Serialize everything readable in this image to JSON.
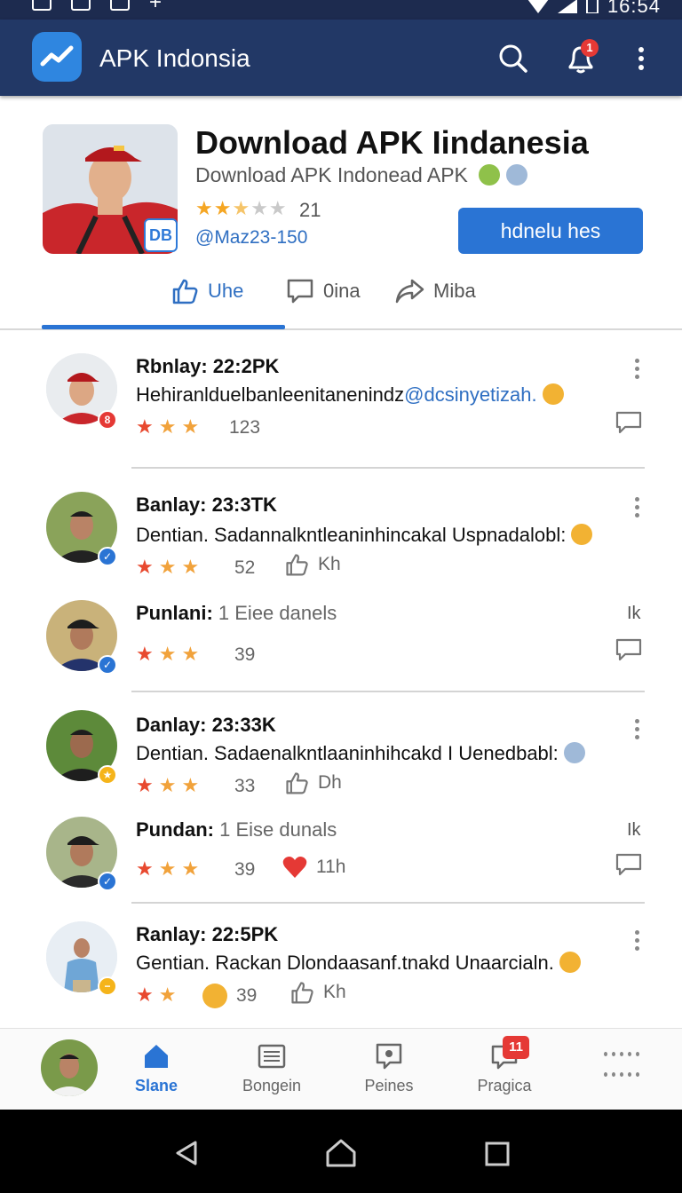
{
  "status_bar": {
    "time": "16:54"
  },
  "app_bar": {
    "title": "APK Indonsia",
    "notification_count": "1",
    "icons": [
      "trending-logo-icon",
      "search-icon",
      "notification-bell-icon",
      "more-vertical-icon"
    ]
  },
  "hero": {
    "title": "Download APK Iindanesia",
    "subtitle": "Download APK Indonead APK",
    "rating": 2.5,
    "rating_count": "21",
    "handle": "@Maz23-150",
    "badge": "DB",
    "button_label": "hdnelu hes",
    "accent_color": "#2a74d4"
  },
  "tabs": [
    {
      "label": "Uhe",
      "icon": "thumbs-up-icon",
      "active": true
    },
    {
      "label": "0ina",
      "icon": "comment-icon",
      "active": false
    },
    {
      "label": "Miba",
      "icon": "share-icon",
      "active": false
    }
  ],
  "feed": [
    {
      "name": "Rbnlay: 22:2PK",
      "text": "Hehiranlduelbanleenitanenindz",
      "mention": "@dcsinyetizah.",
      "rating": 2.5,
      "count": "123",
      "avatar_badge": "8",
      "badge_color": "#e53935",
      "action": "comment"
    },
    {
      "name": "Banlay: 23:3TK",
      "text": "Dentian. Sadannalkntleaninhincakal Uspnadalobl:",
      "rating": 2.5,
      "count": "52",
      "like_label": "Kh",
      "badge_color": "#2a74d4",
      "action": "more"
    },
    {
      "name": "Punlani:",
      "name_light": "1 Eiee danels",
      "right_label": "Ik",
      "rating": 2.5,
      "count": "39",
      "badge_color": "#2a74d4",
      "action": "comment"
    },
    {
      "name": "Danlay: 23:33K",
      "text": "Dentian. Sadaenalkntlaaninhihcakd I Uenedbabl:",
      "rating": 2.5,
      "count": "33",
      "like_label": "Dh",
      "badge_color": "#f5b41a",
      "action": "more"
    },
    {
      "name": "Pundan:",
      "name_light": "1 Eise dunals",
      "right_label": "Ik",
      "rating": 2.5,
      "count": "39",
      "heart_label": "11h",
      "badge_color": "#2a74d4",
      "action": "comment"
    },
    {
      "name": "Ranlay: 22:5PK",
      "text": "Gentian. Rackan Dlondaasanf.tnakd Unaarcialn.",
      "rating": 2,
      "count": "39",
      "like_label": "Kh",
      "badge_color": "#f5b41a",
      "action": "more"
    }
  ],
  "bottom_nav": [
    {
      "label": "Slane",
      "icon": "home-icon",
      "active": true
    },
    {
      "label": "Bongein",
      "icon": "newspaper-icon",
      "active": false
    },
    {
      "label": "Peines",
      "icon": "photo-icon",
      "active": false
    },
    {
      "label": "Pragica",
      "icon": "chat-icon",
      "active": false,
      "badge": "11"
    }
  ],
  "system_nav": [
    "back-icon",
    "home-circle-icon",
    "recents-icon"
  ]
}
